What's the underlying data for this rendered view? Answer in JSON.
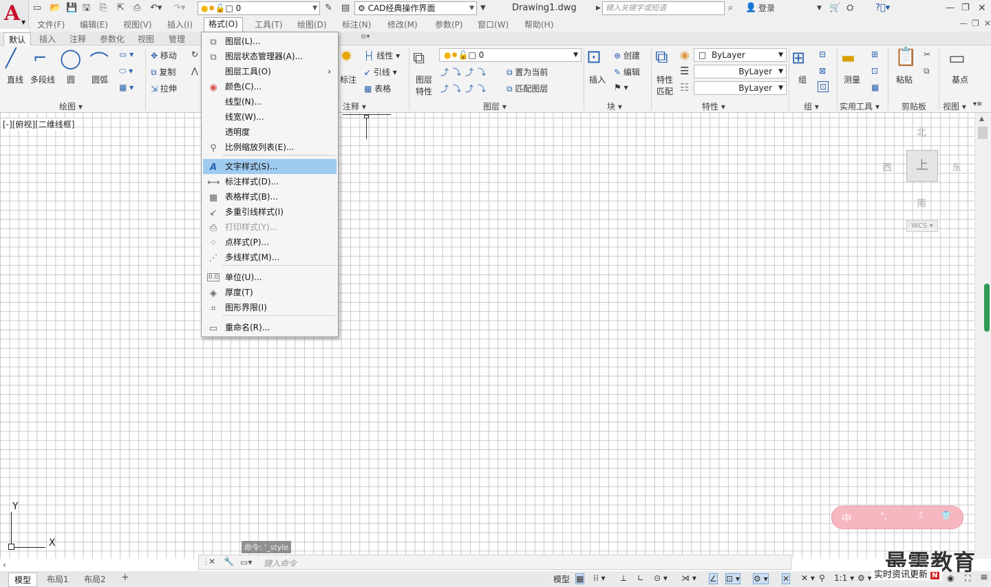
{
  "titlebar": {
    "layer_value": "0",
    "workspace": "CAD经典操作界面",
    "doc_title": "Drawing1.dwg",
    "search_placeholder": "键入关键字或短语",
    "login": "登录"
  },
  "menubar": [
    "文件(F)",
    "编辑(E)",
    "视图(V)",
    "插入(I)",
    "格式(O)",
    "工具(T)",
    "绘图(D)",
    "标注(N)",
    "修改(M)",
    "参数(P)",
    "窗口(W)",
    "帮助(H)"
  ],
  "ribbon_tabs": [
    "默认",
    "插入",
    "注释",
    "参数化",
    "视图",
    "管理"
  ],
  "ribbon": {
    "draw": {
      "line": "直线",
      "polyline": "多段线",
      "circle": "圆",
      "arc": "圆弧",
      "panel": "绘图"
    },
    "modify": {
      "move": "移动",
      "copy": "复制",
      "stretch": "拉伸"
    },
    "annotation": {
      "dim": "标注",
      "leader": "引线",
      "table": "表格",
      "linear": "线性",
      "panel": "注释"
    },
    "layers": {
      "props": "图层",
      "props2": "特性",
      "layer_value": "0",
      "set_current": "置为当前",
      "match": "匹配图层",
      "panel": "图层"
    },
    "block": {
      "insert": "插入",
      "create": "创建",
      "edit": "编辑",
      "panel": "块"
    },
    "properties": {
      "match": "特性",
      "match2": "匹配",
      "color": "ByLayer",
      "linetype": "ByLayer",
      "lineweight": "ByLayer",
      "panel": "特性"
    },
    "groups": {
      "group": "组",
      "panel": "组"
    },
    "utilities": {
      "measure": "测量",
      "panel": "实用工具"
    },
    "clipboard": {
      "paste": "粘贴",
      "panel": "剪贴板"
    },
    "view": {
      "base": "基点",
      "panel": "视图"
    }
  },
  "viewport_label": "[-][俯视][二维线框]",
  "format_menu": [
    {
      "label": "图层(L)...",
      "icon": "layers-icon"
    },
    {
      "label": "图层状态管理器(A)...",
      "icon": "layer-state-icon"
    },
    {
      "label": "图层工具(O)",
      "icon": "",
      "submenu": "›"
    },
    {
      "label": "颜色(C)...",
      "icon": "color-wheel-icon"
    },
    {
      "label": "线型(N)...",
      "icon": ""
    },
    {
      "label": "线宽(W)...",
      "icon": ""
    },
    {
      "label": "透明度",
      "icon": ""
    },
    {
      "label": "比例缩放列表(E)...",
      "icon": "scale-list-icon"
    },
    {
      "label": "文字样式(S)...",
      "icon": "text-style-icon"
    },
    {
      "label": "标注样式(D)...",
      "icon": "dim-style-icon"
    },
    {
      "label": "表格样式(B)...",
      "icon": "table-style-icon"
    },
    {
      "label": "多重引线样式(I)",
      "icon": "mleader-style-icon"
    },
    {
      "label": "打印样式(Y)...",
      "icon": "plot-style-icon"
    },
    {
      "label": "点样式(P)...",
      "icon": "point-style-icon"
    },
    {
      "label": "多线样式(M)...",
      "icon": "mline-style-icon"
    },
    {
      "label": "单位(U)...",
      "icon": "units-icon"
    },
    {
      "label": "厚度(T)",
      "icon": "thickness-icon"
    },
    {
      "label": "图形界限(I)",
      "icon": "limits-icon"
    },
    {
      "label": "重命名(R)...",
      "icon": "rename-icon"
    }
  ],
  "viewcube": {
    "north": "北",
    "south": "南",
    "east": "东",
    "west": "西",
    "top": "上",
    "wcs": "WCS"
  },
  "command": {
    "history": "命令: '_style",
    "placeholder": "键入命令"
  },
  "layout_tabs": [
    "模型",
    "布局1",
    "布局2"
  ],
  "status": {
    "model": "模型",
    "scale": "1:1"
  },
  "watermark": {
    "brand": "最需教育",
    "news": "实时资讯更新"
  },
  "ucs": {
    "x": "X",
    "y": "Y"
  },
  "colors": {
    "highlight": "#9fcbf0",
    "brand_red": "#c8102e"
  }
}
